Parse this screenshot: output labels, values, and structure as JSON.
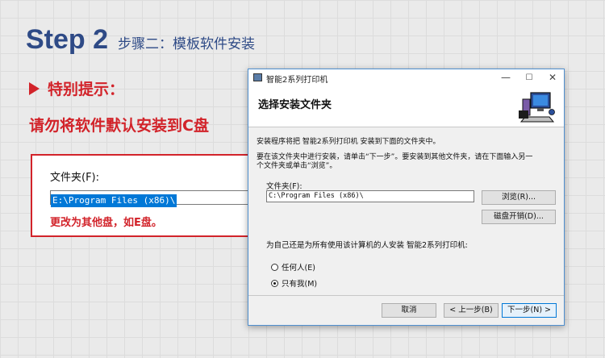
{
  "slide": {
    "step": "Step 2",
    "step_sub": "步骤二：模板软件安装",
    "tip_heading": "特别提示：",
    "instruction": "请勿将软件默认安装到C盘"
  },
  "callout": {
    "folder_label": "文件夹(F):",
    "folder_value": "E:\\Program Files (x86)\\",
    "note": "更改为其他盘，如E盘。"
  },
  "dialog": {
    "window_title": "智能2系列打印机",
    "minimize": "—",
    "maximize": "☐",
    "close": "✕",
    "header_title": "选择安装文件夹",
    "intro": "安装程序将把 智能2系列打印机 安装到下面的文件夹中。",
    "instruction_line1": "要在该文件夹中进行安装，请单击“下一步”。要安装到其他文件夹，请在下面输入另一",
    "instruction_line2": "个文件夹或单击“浏览”。",
    "folder_label": "文件夹(F):",
    "folder_value": "C:\\Program Files (x86)\\",
    "browse_button": "浏览(R)...",
    "disk_cost_button": "磁盘开销(D)...",
    "install_for_text": "为自己还是为所有使用该计算机的人安装 智能2系列打印机:",
    "radio_everyone": "任何人(E)",
    "radio_just_me": "只有我(M)",
    "selected_option": "只有我(M)",
    "cancel_button": "取消",
    "back_button": "< 上一步(B)",
    "next_button": "下一步(N) >"
  },
  "colors": {
    "accent_red": "#d2232a",
    "title_blue": "#2e4a86",
    "selection_blue": "#0078d7"
  }
}
